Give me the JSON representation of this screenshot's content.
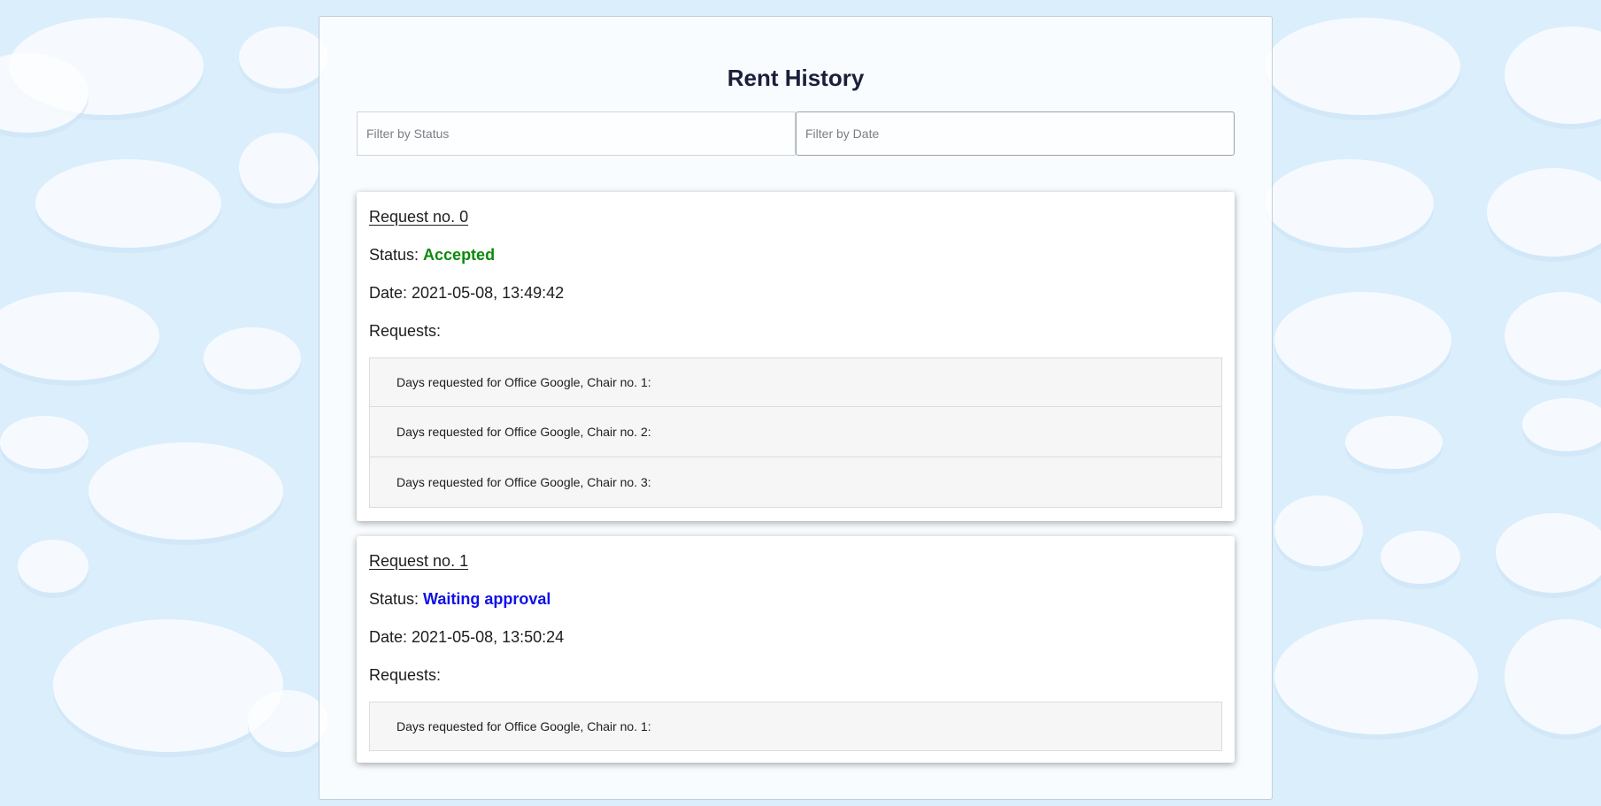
{
  "page": {
    "title": "Rent History"
  },
  "filters": {
    "status_placeholder": "Filter by Status",
    "date_placeholder": "Filter by Date"
  },
  "labels": {
    "status": "Status: ",
    "date": "Date: ",
    "requests": "Requests:"
  },
  "colors": {
    "accepted": "#0a8a0a",
    "waiting": "#1010e8",
    "background": "#dbeefb"
  },
  "requests": [
    {
      "title": "Request no. 0",
      "status": "Accepted",
      "date": "2021-05-08, 13:49:42",
      "items": [
        "Days requested for Office Google, Chair no. 1:",
        "Days requested for Office Google, Chair no. 2:",
        "Days requested for Office Google, Chair no. 3:"
      ]
    },
    {
      "title": "Request no. 1",
      "status": "Waiting approval",
      "date": "2021-05-08, 13:50:24",
      "items": [
        "Days requested for Office Google, Chair no. 1:"
      ]
    }
  ]
}
